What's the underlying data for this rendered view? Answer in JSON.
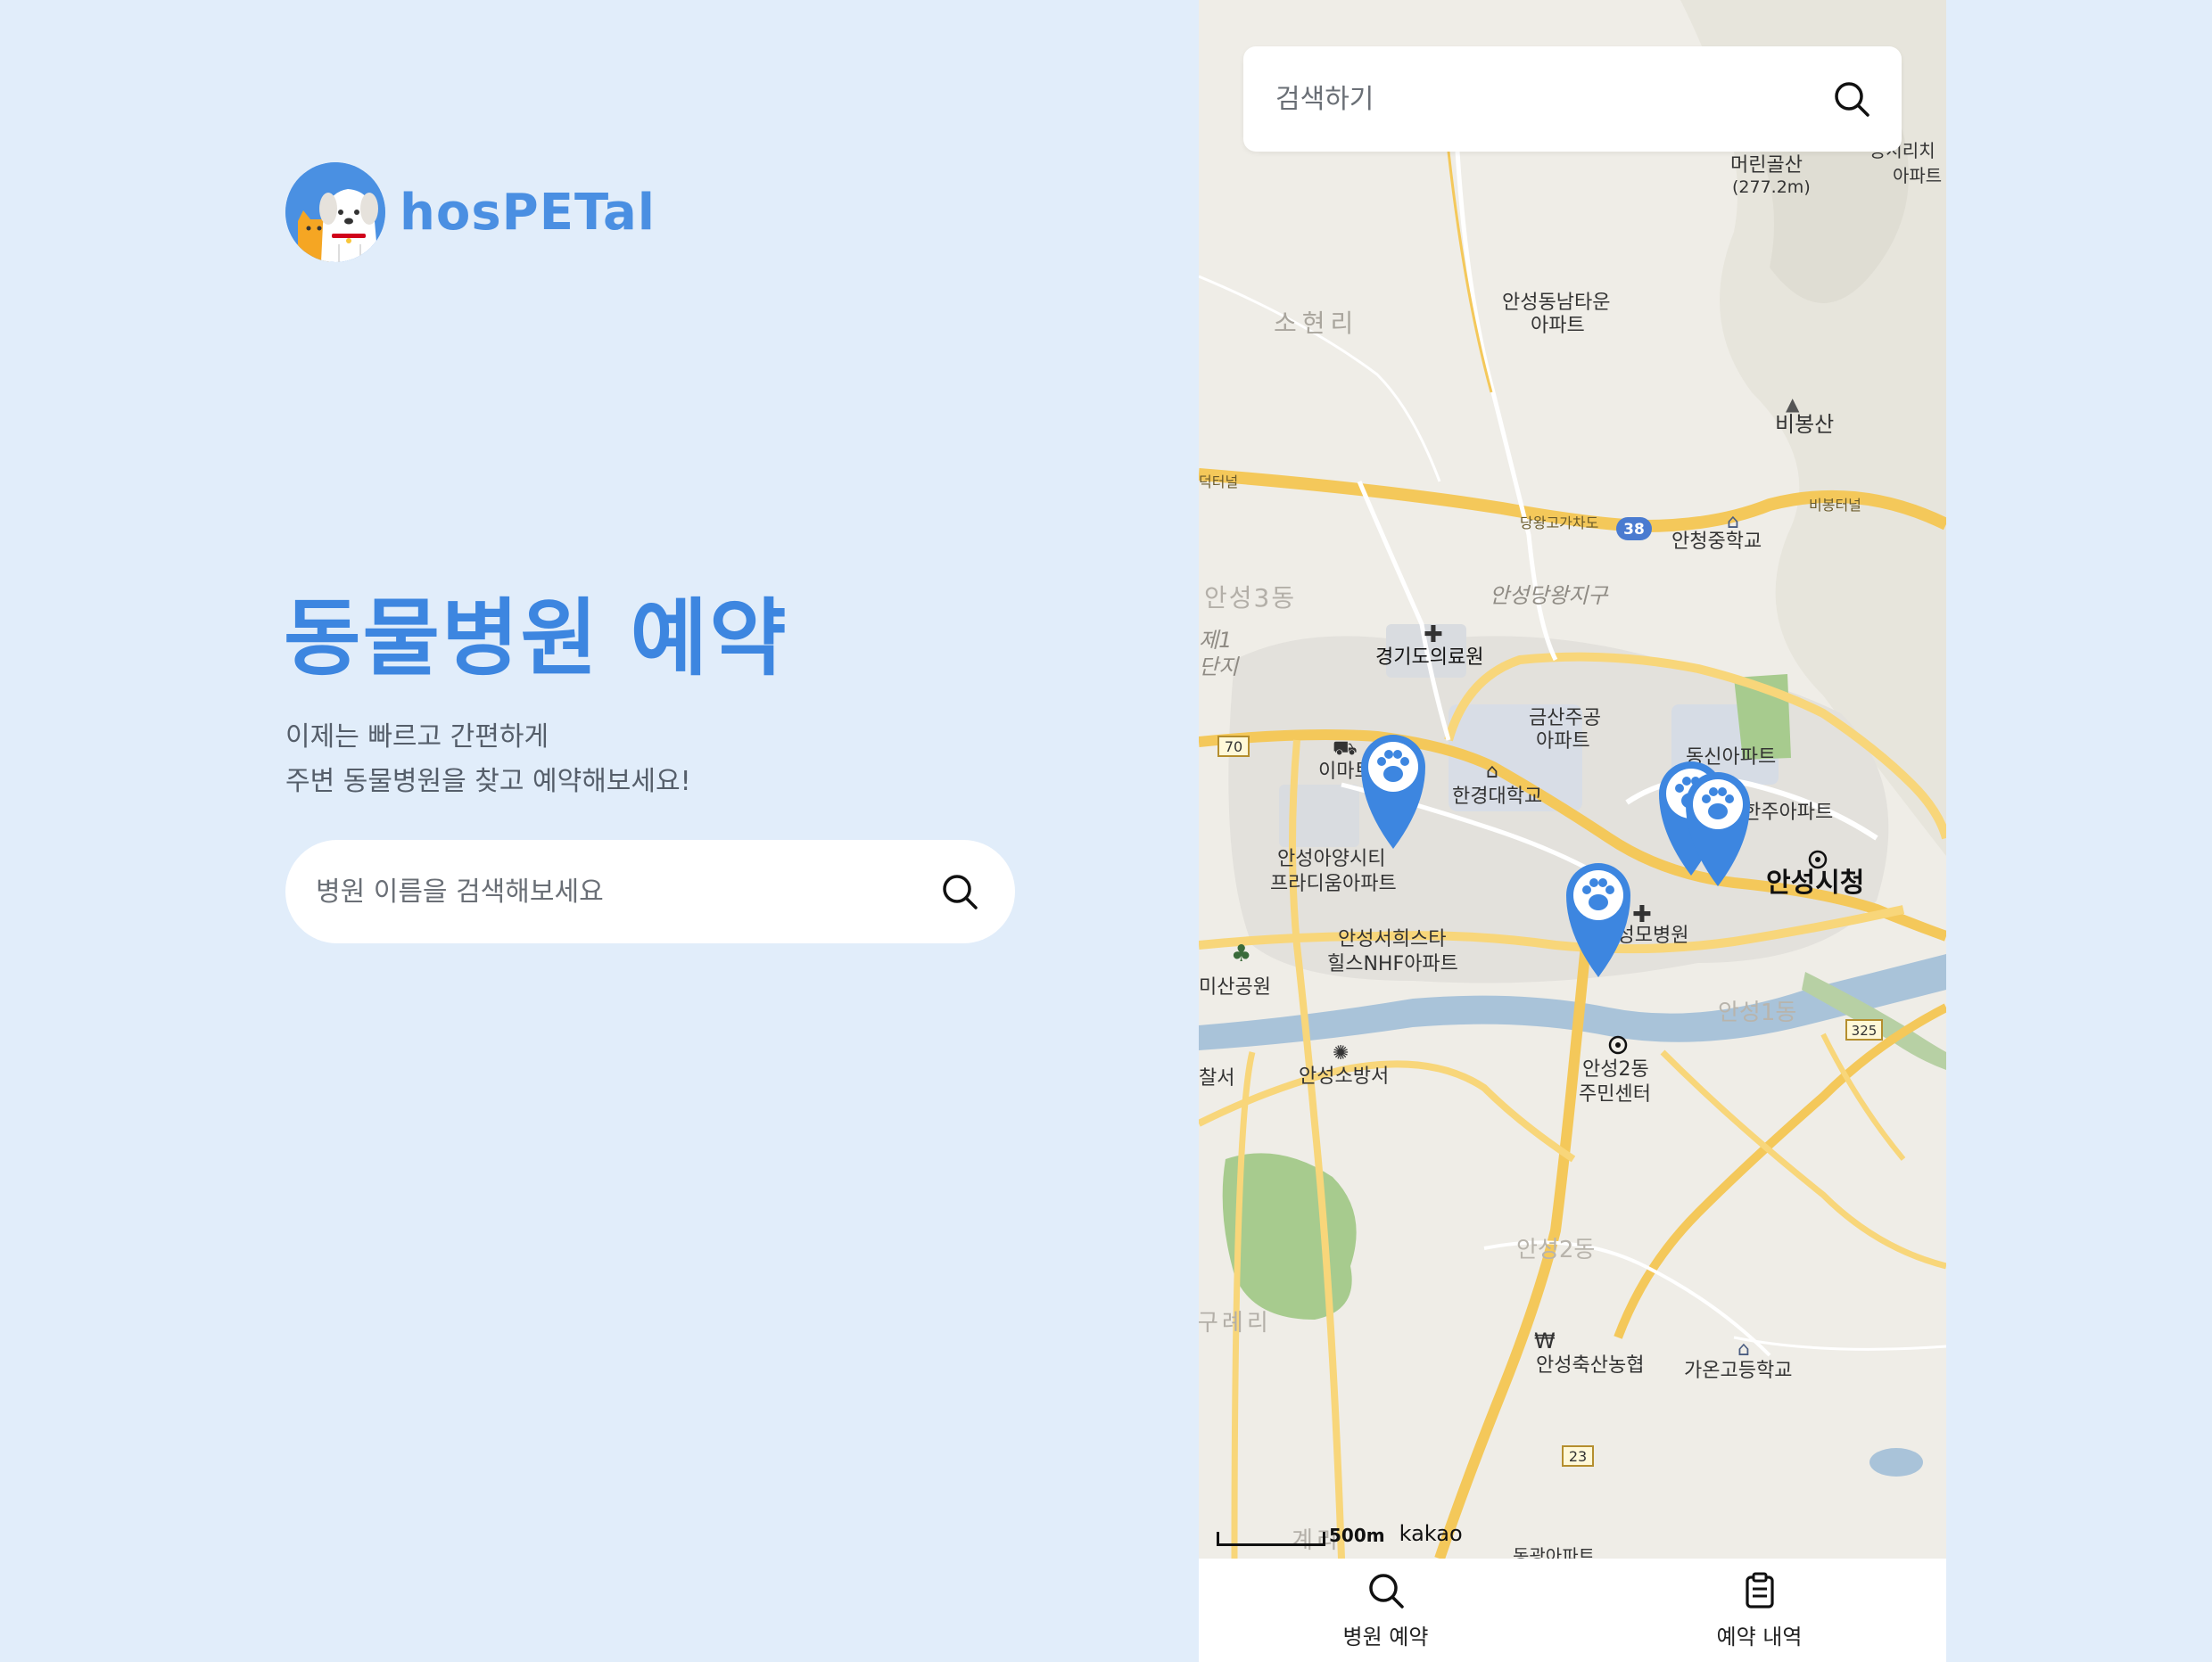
{
  "brand": {
    "name": "hosPETal"
  },
  "hero": {
    "title": "동물병원 예약",
    "subtitle_line1": "이제는 빠르고 간편하게",
    "subtitle_line2": "주변 동물병원을 찾고 예약해보세요!",
    "search_placeholder": "병원 이름을 검색해보세요"
  },
  "map": {
    "search_placeholder": "검색하기",
    "scale_label": "500m",
    "attribution": "kakao",
    "labels": {
      "mountain1": "머린골산",
      "mountain1_height": "(277.2m)",
      "apt_top_right": "공시리치",
      "apt_top_right2": "아파트",
      "sohyeonri": "소현리",
      "dongnam_town": "안성동남타운",
      "dongnam_apt": "아파트",
      "bibongsan": "비봉산",
      "tunnel_left": "덕터널",
      "tunnel_right": "비봉터널",
      "overpass": "당왕고가차도",
      "route38": "38",
      "ancheong_ms": "안청중학교",
      "anseong3dong": "안성3동",
      "dangwang": "안성당왕지구",
      "industrial": "제1",
      "industrial2": "단지",
      "medical": "경기도의료원",
      "route70": "70",
      "geumsan": "금산주공",
      "geumsan_apt": "아파트",
      "emart": "이마트",
      "hankyong": "한경대학교",
      "dongsin": "동신아파트",
      "hanju": "한주아파트",
      "anyang_city": "안성아양시티",
      "pradium": "프라디움아파트",
      "city_hall": "안성시청",
      "seongmo": "안성성모병원",
      "seohee1": "안성서희스타",
      "seohee2": "힐스NHF아파트",
      "misan": "미산공원",
      "anseong1dong": "안성1동",
      "route325": "325",
      "police": "찰서",
      "fire": "안성소방서",
      "center1": "안성2동",
      "center2": "주민센터",
      "anseong2dong": "안성2동",
      "guraeri": "구례리",
      "nonghyup": "안성축산농협",
      "gaon": "가온고등학교",
      "route23": "23",
      "gyeri": "계리",
      "donggwang": "동광아파트"
    },
    "markers": [
      {
        "name": "hospital-marker-1",
        "icon": "paw-icon"
      },
      {
        "name": "hospital-marker-2",
        "icon": "paw-icon"
      },
      {
        "name": "hospital-marker-3",
        "icon": "paw-icon"
      },
      {
        "name": "hospital-marker-4",
        "icon": "paw-icon"
      }
    ]
  },
  "nav": {
    "hospital_booking": "병원 예약",
    "booking_history": "예약 내역"
  },
  "colors": {
    "accent": "#3D86E0",
    "background": "#E1EDFA",
    "map_road_major": "#F4C85A",
    "map_river": "#A9C3D9",
    "map_park": "#A7CB8E"
  }
}
